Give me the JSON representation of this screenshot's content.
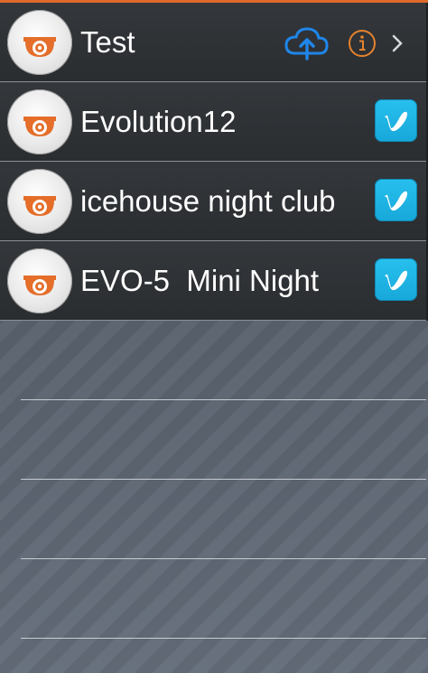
{
  "theme": {
    "accent": "#e06a2c",
    "upload_blue": "#1f86e8",
    "info_orange": "#e4822e",
    "vimeo_blue": "#1ab7ea"
  },
  "cameras": [
    {
      "name": "Test",
      "avatar_icon": "security-camera-icon",
      "actions": [
        "cloud-upload-icon",
        "info-icon",
        "chevron-right-icon"
      ]
    },
    {
      "name": "Evolution12",
      "avatar_icon": "security-camera-icon",
      "actions": [
        "vimeo-icon"
      ]
    },
    {
      "name": "icehouse night club",
      "avatar_icon": "security-camera-icon",
      "actions": [
        "vimeo-icon"
      ]
    },
    {
      "name": "EVO-5  Mini Night",
      "avatar_icon": "security-camera-icon",
      "actions": [
        "vimeo-icon"
      ]
    }
  ],
  "empty_rows": 4
}
